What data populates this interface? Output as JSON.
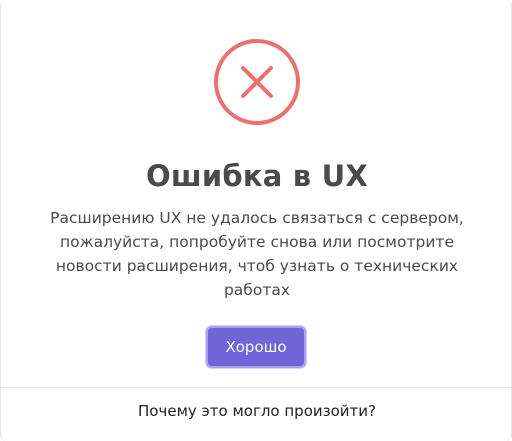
{
  "dialog": {
    "icon": "close-circle-icon",
    "icon_color": "#ec7072",
    "title": "Ошибка в UX",
    "message": "Расширению UX не удалось связаться с сервером, пожалуйста, попробуйте снова или посмотрите новости расширения, чтоб узнать о технических работах",
    "ok_label": "Хорошо",
    "button_color": "#7163d8",
    "help_link": "Почему это могло произойти?"
  }
}
